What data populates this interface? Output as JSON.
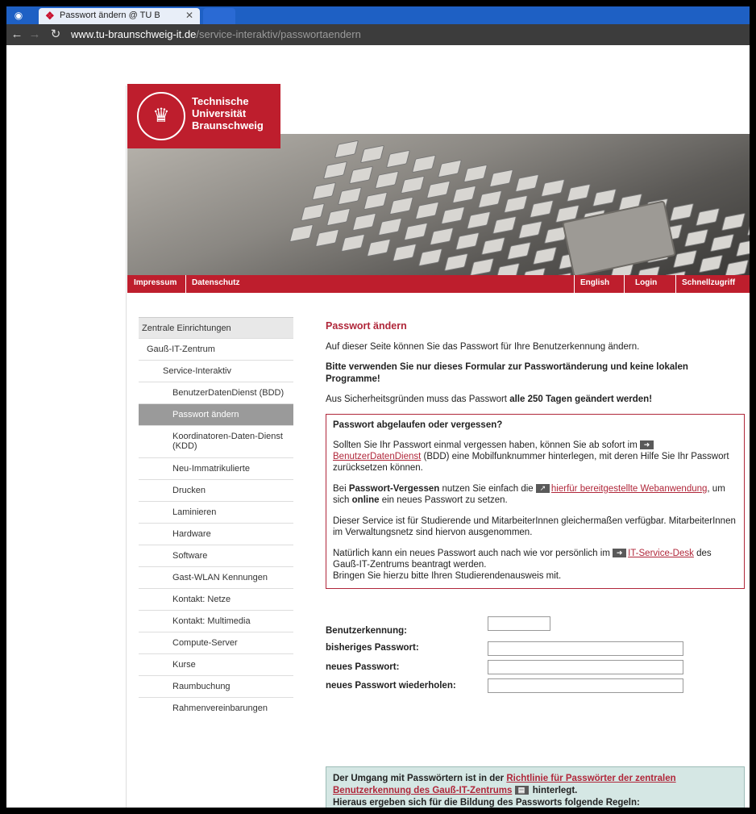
{
  "browser": {
    "tab_title": "Passwort ändern @ TU B",
    "tab_favicon": "tu-seal-icon",
    "url_host": "www.tu-braunschweig-it.de",
    "url_path": "/service-interaktiv/passwortaendern"
  },
  "site": {
    "logo_line1": "Technische",
    "logo_line2": "Universität",
    "logo_line3": "Braunschweig",
    "brand_color": "#be1e2d",
    "nav": {
      "impressum": "Impressum",
      "datenschutz": "Datenschutz",
      "english": "English",
      "login": "Login",
      "schnellzugriff": "Schnellzugriff"
    }
  },
  "sidebar": {
    "items": [
      {
        "label": "Zentrale Einrichtungen"
      },
      {
        "label": "Gauß-IT-Zentrum"
      },
      {
        "label": "Service-Interaktiv"
      },
      {
        "label": "BenutzerDatenDienst (BDD)"
      },
      {
        "label": "Passwort ändern"
      },
      {
        "label": "Koordinatoren-Daten-Dienst (KDD)"
      },
      {
        "label": "Neu-Immatrikulierte"
      },
      {
        "label": "Drucken"
      },
      {
        "label": "Laminieren"
      },
      {
        "label": "Hardware"
      },
      {
        "label": "Software"
      },
      {
        "label": "Gast-WLAN Kennungen"
      },
      {
        "label": "Kontakt: Netze"
      },
      {
        "label": "Kontakt: Multimedia"
      },
      {
        "label": "Compute-Server"
      },
      {
        "label": "Kurse"
      },
      {
        "label": "Raumbuchung"
      },
      {
        "label": "Rahmenvereinbarungen"
      }
    ]
  },
  "content": {
    "title": "Passwort ändern",
    "intro": "Auf dieser Seite können Sie das Passwort für Ihre Benutzerkennung ändern.",
    "warning": "Bitte verwenden Sie nur dieses Formular zur Passwortänderung und keine lokalen Programme!",
    "security_prefix": "Aus Sicherheitsgründen muss das Passwort ",
    "security_bold": "alle 250 Tagen geändert werden!",
    "notice": {
      "title": "Passwort abgelaufen oder vergessen?",
      "p1_a": "Sollten Sie Ihr Passwort einmal vergessen haben, können Sie ab sofort im ",
      "p1_link": "BenutzerDatenDienst",
      "p1_b": " (BDD) eine Mobilfunknummer hinterlegen, mit deren Hilfe Sie Ihr Passwort zurücksetzen können.",
      "p2_a": "Bei ",
      "p2_bold": "Passwort-Vergessen",
      "p2_b": " nutzen Sie einfach die ",
      "p2_link": "hierfür bereitgestellte Webanwendung",
      "p2_c": ", um sich ",
      "p2_bold2": "online",
      "p2_d": " ein neues Passwort zu setzen.",
      "p3": "Dieser Service ist für Studierende und MitarbeiterInnen gleichermaßen verfügbar. MitarbeiterInnen im Verwaltungsnetz sind hiervon ausgenommen.",
      "p4_a": "Natürlich kann ein neues Passwort auch nach wie vor persönlich im ",
      "p4_link": "IT-Service-Desk",
      "p4_b": " des Gauß-IT-Zentrums beantragt werden.",
      "p4_c": "Bringen Sie hierzu bitte Ihren Studierendenausweis mit."
    },
    "form": {
      "username_label": "Benutzerkennung:",
      "old_pw_label": "bisheriges Passwort:",
      "new_pw_label": "neues Passwort:",
      "repeat_pw_label": "neues Passwort wiederholen:",
      "username_value": "",
      "old_pw_value": "",
      "new_pw_value": "",
      "repeat_pw_value": ""
    },
    "rules": {
      "a": "Der Umgang mit Passwörtern ist in der ",
      "link": "Richtlinie für Passwörter der zentralen Benutzerkennung des Gauß-IT-Zentrums",
      "b": " hinterlegt.",
      "c": "Hieraus ergeben sich für die Bildung des Passworts folgende Regeln:"
    }
  }
}
